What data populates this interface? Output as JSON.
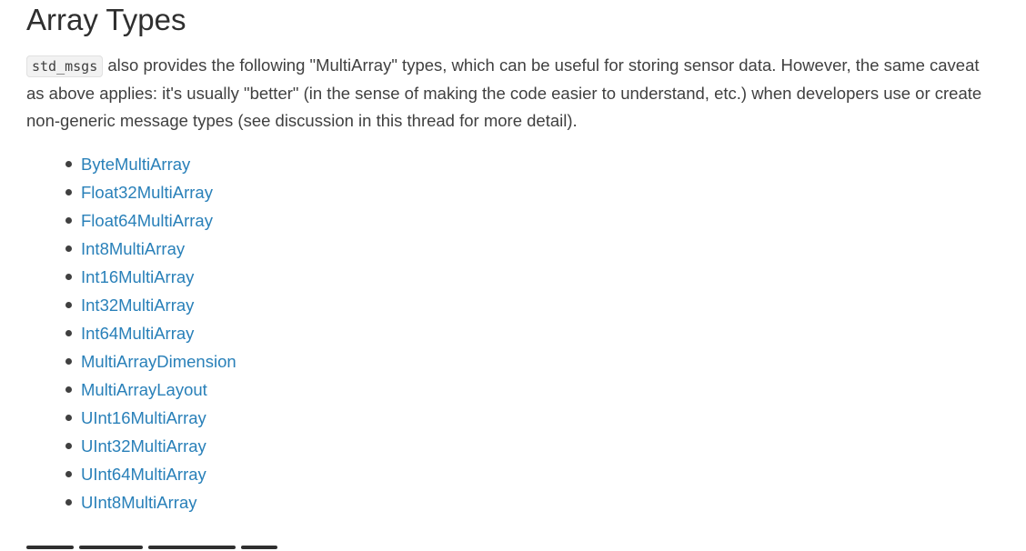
{
  "section": {
    "title": "Array Types",
    "intro": {
      "code": "std_msgs",
      "text": " also provides the following \"MultiArray\" types, which can be useful for storing sensor data. However, the same caveat as above applies: it's usually \"better\" (in the sense of making the code easier to understand, etc.) when developers use or create non-generic message types (see discussion in this thread for more detail)."
    },
    "types": [
      "ByteMultiArray",
      "Float32MultiArray",
      "Float64MultiArray",
      "Int8MultiArray",
      "Int16MultiArray",
      "Int32MultiArray",
      "Int64MultiArray",
      "MultiArrayDimension",
      "MultiArrayLayout",
      "UInt16MultiArray",
      "UInt32MultiArray",
      "UInt64MultiArray",
      "UInt8MultiArray"
    ]
  },
  "colors": {
    "link": "#2980b9",
    "text": "#404040",
    "heading": "#2f2f2f",
    "code_bg": "#f2f2f2"
  }
}
